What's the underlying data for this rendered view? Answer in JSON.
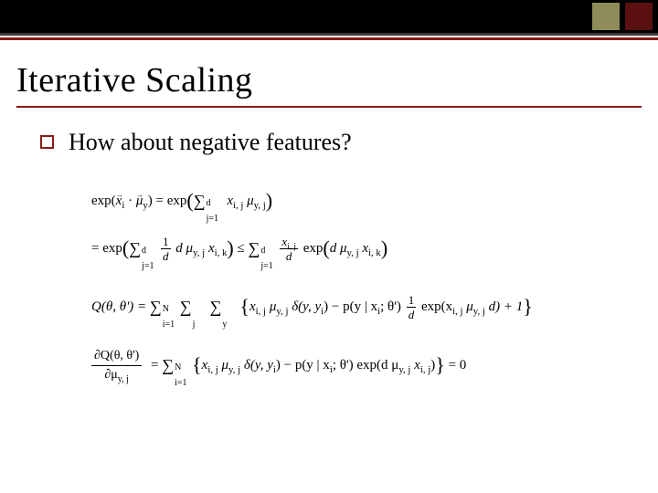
{
  "title": "Iterative Scaling",
  "bullet": "How about negative features?",
  "eq": {
    "line1a_pre": "exp(",
    "line1a_x": "x",
    "line1a_xi": "i",
    "line1a_dot": " · ",
    "line1a_mu": "μ",
    "line1a_muy": "y",
    "line1a_mid": ") = exp",
    "sum_d_top": "d",
    "sum_d_bot": "j=1",
    "line1a_sumbody": " x",
    "line1a_ij": "i, j",
    "line1a_sp": " μ",
    "line1a_yj": "y, j",
    "line1b_lead": "= exp",
    "frac_1": "1",
    "frac_d": "d",
    "line1b_dmu": " d μ",
    "line1b_yj": "y, j",
    "line1b_x": " x",
    "line1b_ik": "i, k",
    "line1b_leq": " ≤ ",
    "line1b_sum2top": "d",
    "line1b_sum2bot": "j=1",
    "frac_xij": "x",
    "frac_xij_sub": "i, j",
    "line1b_exp": " exp",
    "line1b_inparen": "d μ",
    "line1b_inparen_yj": "y, j",
    "line1b_inparen_x": " x",
    "line1b_inparen_ik": "i, k",
    "line2_Q": "Q(θ, θ') = ",
    "sum_N_top": "N",
    "sum_N_bot": "i=1",
    "sum_j_bot": "j",
    "sum_y_bot": "y",
    "line2_term1_x": "x",
    "line2_term1_ij": "i, j",
    "line2_term1_mu": " μ",
    "line2_term1_yj": "y, j",
    "line2_delta": " δ(y, y",
    "line2_delta_i": "i",
    "line2_delta_close": ") − p(y | x",
    "line2_px_i": "i",
    "line2_pxth": "; θ') ",
    "line2_exp": " exp(x",
    "line2_exp_ij": "i, j",
    "line2_exp_mu": " μ",
    "line2_exp_yj": "y, j",
    "line2_exp_d": " d) + 1",
    "line3_frac_num": "∂Q(θ, θ')",
    "line3_frac_den_a": "∂μ",
    "line3_frac_den_yj": "y, j",
    "line3_eq": " = ",
    "line3_term1_x": "x",
    "line3_term1_ij": "i, j",
    "line3_term1_mu": " μ",
    "line3_term1_yj": "y, j",
    "line3_delta": " δ(y, y",
    "line3_delta_i": "i",
    "line3_delta_close": ") − p(y | x",
    "line3_px_i": "i",
    "line3_pxth": "; θ') exp(d μ",
    "line3_exp_yj": "y, j",
    "line3_exp_x": " x",
    "line3_exp_ij": "i, j",
    "line3_close": ")",
    "line3_eq0": " = 0"
  }
}
